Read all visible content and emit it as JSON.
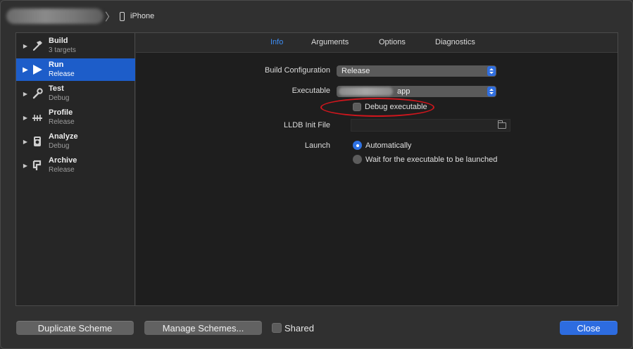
{
  "topbar": {
    "device_label": "iPhone"
  },
  "sidebar": {
    "items": [
      {
        "name": "Build",
        "sub": "3 targets",
        "icon": "hammer-icon",
        "selected": false
      },
      {
        "name": "Run",
        "sub": "Release",
        "icon": "play-icon",
        "selected": true
      },
      {
        "name": "Test",
        "sub": "Debug",
        "icon": "wrench-icon",
        "selected": false
      },
      {
        "name": "Profile",
        "sub": "Release",
        "icon": "gauge-icon",
        "selected": false
      },
      {
        "name": "Analyze",
        "sub": "Debug",
        "icon": "analyze-icon",
        "selected": false
      },
      {
        "name": "Archive",
        "sub": "Release",
        "icon": "archive-icon",
        "selected": false
      }
    ]
  },
  "tabs": [
    {
      "label": "Info",
      "active": true
    },
    {
      "label": "Arguments",
      "active": false
    },
    {
      "label": "Options",
      "active": false
    },
    {
      "label": "Diagnostics",
      "active": false
    }
  ],
  "form": {
    "build_config_label": "Build Configuration",
    "build_config_value": "Release",
    "executable_label": "Executable",
    "executable_value_suffix": "app",
    "debug_executable_label": "Debug executable",
    "debug_executable_checked": false,
    "lldb_label": "LLDB Init File",
    "lldb_value": "",
    "launch_label": "Launch",
    "launch_options": [
      {
        "label": "Automatically",
        "selected": true
      },
      {
        "label": "Wait for the executable to be launched",
        "selected": false
      }
    ]
  },
  "footer": {
    "duplicate_label": "Duplicate Scheme",
    "manage_label": "Manage Schemes...",
    "shared_label": "Shared",
    "shared_checked": false,
    "close_label": "Close"
  },
  "colors": {
    "accent": "#2d6ce0",
    "selection": "#1d5dc9",
    "annotation": "#d0161d"
  }
}
